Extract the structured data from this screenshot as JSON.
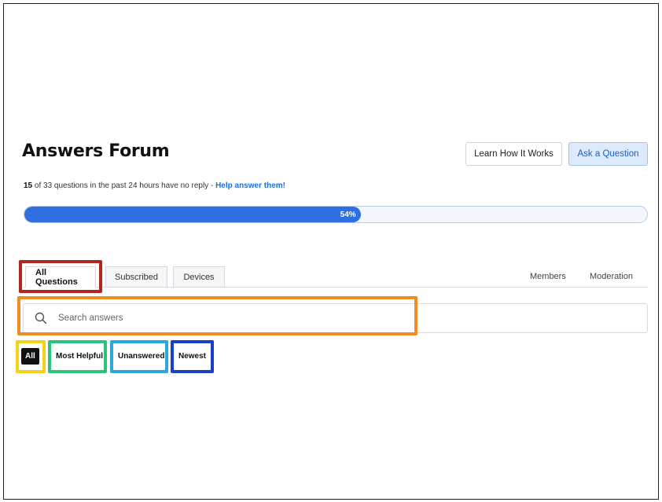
{
  "header": {
    "title": "Answers Forum",
    "learn_button": "Learn How It Works",
    "ask_button": "Ask a Question"
  },
  "stats": {
    "count": "15",
    "text": " of 33 questions in the past 24 hours have no reply - ",
    "link": "Help answer them!"
  },
  "progress": {
    "value": 0.54,
    "label": "54%"
  },
  "tabs": [
    {
      "label": "All Questions",
      "active": true
    },
    {
      "label": "Subscribed",
      "active": false
    },
    {
      "label": "Devices",
      "active": false
    }
  ],
  "right_tabs": [
    "Members",
    "Moderation"
  ],
  "search": {
    "placeholder": "Search answers",
    "value": ""
  },
  "filters": [
    {
      "label": "All",
      "selected": true
    },
    {
      "label": "Most Helpful",
      "selected": false
    },
    {
      "label": "Unanswered",
      "selected": false
    },
    {
      "label": "Newest",
      "selected": false
    }
  ],
  "colors": {
    "accent": "#2f6fe0",
    "highlight_all_questions": "#b3261e",
    "highlight_search": "#f08c24",
    "highlight_all": "#f2d21b",
    "highlight_most_helpful": "#2bc47a",
    "highlight_unanswered": "#2aa9d9",
    "highlight_newest": "#1b3fc9"
  },
  "icons": {
    "search": "search-icon"
  }
}
